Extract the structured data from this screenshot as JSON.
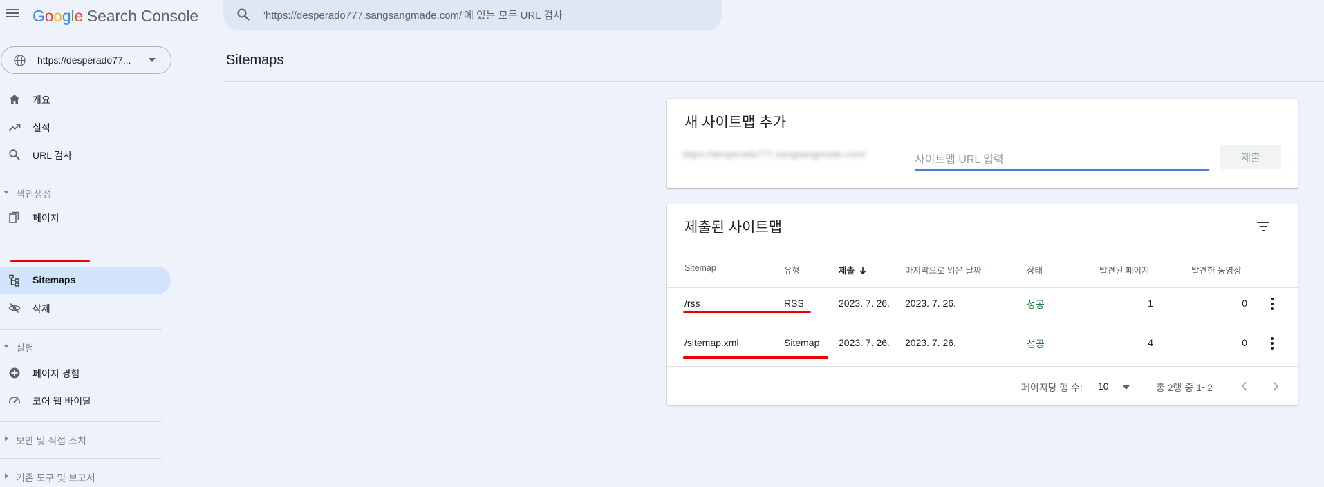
{
  "topbar": {
    "brand_letters": [
      "G",
      "o",
      "o",
      "g",
      "l",
      "e"
    ],
    "product": "Search Console",
    "search_placeholder": "'https://desperado777.sangsangmade.com/'에 있는 모든 URL 검사"
  },
  "sidebar": {
    "property_label": "https://desperado77...",
    "items_top": [
      {
        "label": "개요",
        "icon": "home-icon"
      },
      {
        "label": "실적",
        "icon": "trending-up-icon"
      },
      {
        "label": "URL 검사",
        "icon": "search-icon"
      }
    ],
    "section_indexing": "색인생성",
    "items_indexing": [
      {
        "label": "페이지",
        "icon": "pages-icon"
      },
      {
        "label": "Sitemaps",
        "icon": "sitemap-icon"
      },
      {
        "label": "삭제",
        "icon": "eye-off-icon"
      }
    ],
    "section_experience": "실험",
    "items_experience": [
      {
        "label": "페이지 경험",
        "icon": "add-circle-icon"
      },
      {
        "label": "코어 웹 바이탈",
        "icon": "speed-gauge-icon"
      }
    ],
    "section_security": "보안 및 직접 조치",
    "section_legacy": "기존 도구 및 보고서"
  },
  "main": {
    "page_title": "Sitemaps",
    "add_card": {
      "title": "새 사이트맵 추가",
      "url_prefix": "https://desperado777.sangsangmade.com/",
      "input_placeholder": "사이트맵 URL 입력",
      "submit_label": "제출"
    },
    "list_card": {
      "title": "제출된 사이트맵",
      "columns": [
        "Sitemap",
        "유형",
        "제출",
        "마지막으로 읽은 날짜",
        "상태",
        "발견된 페이지",
        "발견한 동영상"
      ],
      "rows": [
        {
          "sitemap": "/rss",
          "type": "RSS",
          "submitted": "2023. 7. 26.",
          "last_read": "2023. 7. 26.",
          "status": "성공",
          "pages": "1",
          "videos": "0"
        },
        {
          "sitemap": "/sitemap.xml",
          "type": "Sitemap",
          "submitted": "2023. 7. 26.",
          "last_read": "2023. 7. 26.",
          "status": "성공",
          "pages": "4",
          "videos": "0"
        }
      ],
      "rows_per_page_label": "페이지당 행 수:",
      "rows_per_page_value": "10",
      "range_label": "총 2행 중 1~2"
    }
  },
  "colors": {
    "background": "#eef3fb",
    "active_nav": "#d2e3fc",
    "success": "#188038",
    "annotation_red": "#e00000",
    "input_underline": "#4a7fd6"
  }
}
